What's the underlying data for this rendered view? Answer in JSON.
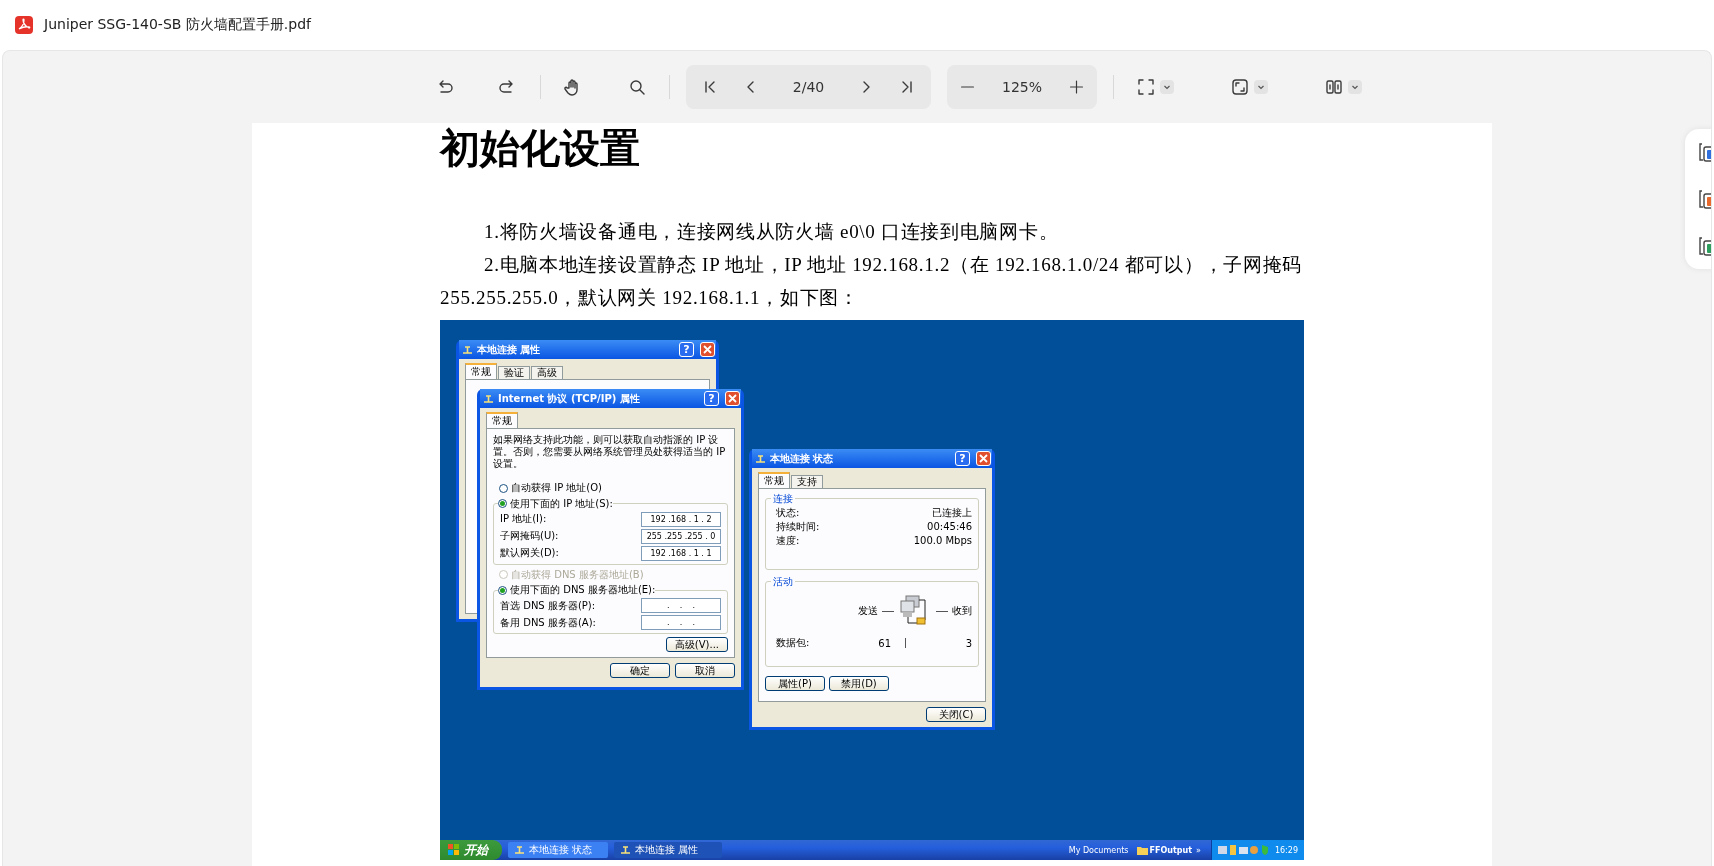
{
  "document_title": "Juniper SSG-140-SB 防火墙配置手册.pdf",
  "toolbar": {
    "page_indicator": "2/40",
    "zoom": "125%"
  },
  "side_tools": [
    {
      "color": "#2f6fde"
    },
    {
      "color": "#e8692c"
    },
    {
      "color": "#2e9e5e"
    }
  ],
  "page": {
    "heading": "初始化设置",
    "paragraphs": [
      "1.将防火墙设备通电，连接网线从防火墙 e0\\0 口连接到电脑网卡。",
      "2.电脑本地连接设置静态 IP 地址，IP 地址 192.168.1.2（在 192.168.1.0/24 都可以），子网掩码 255.255.255.0，默认网关 192.168.1.1，如下图："
    ],
    "screenshot": {
      "dialogs": [
        {
          "kind": "properties",
          "title": "本地连接 属性",
          "help_button": "?",
          "tabs": [
            {
              "label": "常规",
              "selected": true
            },
            {
              "label": "验证",
              "selected": false
            },
            {
              "label": "高级",
              "selected": false
            }
          ]
        },
        {
          "kind": "tcpip",
          "title": "Internet 协议 (TCP/IP) 属性",
          "help_button": "?",
          "tabs": [
            {
              "label": "常规",
              "selected": true
            }
          ],
          "intro": "如果网络支持此功能，则可以获取自动指派的 IP 设置。否则，您需要从网络系统管理员处获得适当的 IP 设置。",
          "ip_options": [
            {
              "label": "自动获得 IP 地址(O)",
              "selected": false,
              "disabled": false
            },
            {
              "label": "使用下面的 IP 地址(S):",
              "selected": true,
              "disabled": false
            }
          ],
          "ip_fields": [
            {
              "label": "IP 地址(I):",
              "value": "192 .168 . 1 . 2"
            },
            {
              "label": "子网掩码(U):",
              "value": "255 .255 .255 . 0"
            },
            {
              "label": "默认网关(D):",
              "value": "192 .168 . 1 . 1"
            }
          ],
          "dns_options": [
            {
              "label": "自动获得 DNS 服务器地址(B)",
              "selected": false,
              "disabled": true
            },
            {
              "label": "使用下面的 DNS 服务器地址(E):",
              "selected": true,
              "disabled": false
            }
          ],
          "dns_fields": [
            {
              "label": "首选 DNS 服务器(P):",
              "value": ".    .    ."
            },
            {
              "label": "备用 DNS 服务器(A):",
              "value": ".    .    ."
            }
          ],
          "advanced_button": "高级(V)...",
          "buttons": [
            "确定",
            "取消"
          ]
        },
        {
          "kind": "status",
          "title": "本地连接 状态",
          "help_button": "?",
          "tabs": [
            {
              "label": "常规",
              "selected": true
            },
            {
              "label": "支持",
              "selected": false
            }
          ],
          "connection_group": "连接",
          "rows": [
            {
              "label": "状态:",
              "value": "已连接上"
            },
            {
              "label": "持续时间:",
              "value": "00:45:46"
            },
            {
              "label": "速度:",
              "value": "100.0 Mbps"
            }
          ],
          "activity_group": "活动",
          "sent_label": "发送",
          "received_label": "收到",
          "packets_label": "数据包:",
          "sent_value": "61",
          "received_value": "3",
          "buttons": [
            "属性(P)",
            "禁用(D)"
          ],
          "close_button": "关闭(C)"
        }
      ],
      "taskbar": {
        "start": "开始",
        "tasks": [
          {
            "label": "本地连接 状态",
            "selected": false
          },
          {
            "label": "本地连接 属性",
            "selected": true
          }
        ],
        "toolbar_label": "My Documents",
        "folder": "FFOutput",
        "chevron": "»",
        "clock": "16:29"
      }
    }
  }
}
